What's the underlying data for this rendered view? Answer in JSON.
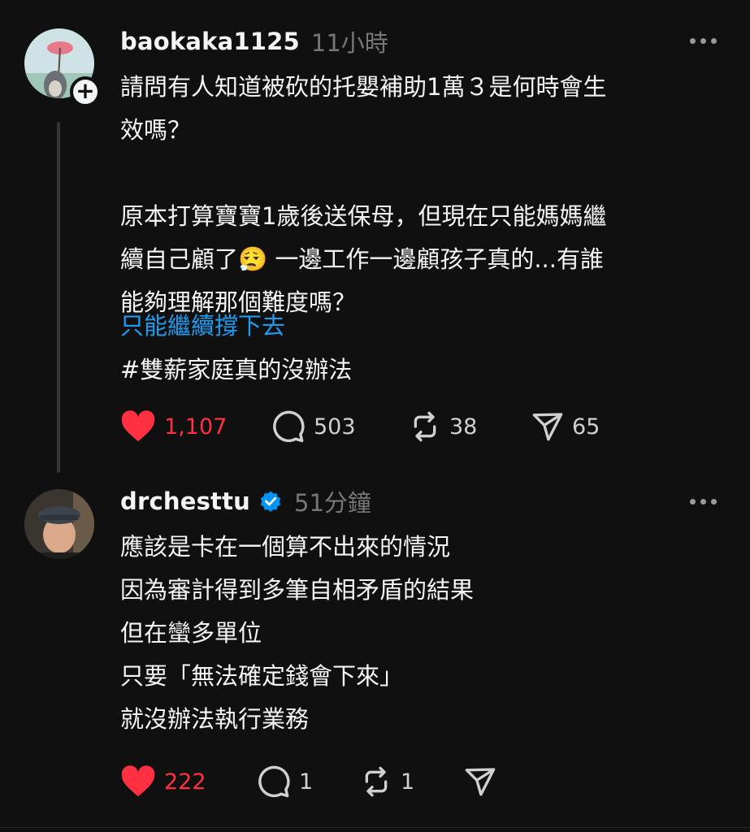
{
  "post1": {
    "username": "baokaka1125",
    "time": "11小時",
    "body": "請問有人知道被砍的托嬰補助1萬３是何時會生\n效嗎？\n\n原本打算寶寶1歲後送保母，但現在只能媽媽繼\n續自己顧了😮‍💨 一邊工作一邊顧孩子真的...有誰\n能夠理解那個難度嗎？",
    "topic_link": "只能繼續撐下去",
    "hashtag": "#雙薪家庭真的沒辦法",
    "likes": "1,107",
    "replies": "503",
    "reposts": "38",
    "shares": "65"
  },
  "post2": {
    "username": "drchesttu",
    "time": "51分鐘",
    "body": "應該是卡在一個算不出來的情況\n因為審計得到多筆自相矛盾的結果\n但在蠻多單位\n只要「無法確定錢會下來」\n就沒辦法執行業務",
    "likes": "222",
    "replies": "1",
    "reposts": "1"
  },
  "colors": {
    "like_red": "#ff3040",
    "link_blue": "#1d9bf0",
    "verified_blue": "#0095f6"
  },
  "icons": [
    "heart-icon",
    "comment-icon",
    "repost-icon",
    "share-icon",
    "verified-icon",
    "more-icon",
    "plus-icon"
  ]
}
